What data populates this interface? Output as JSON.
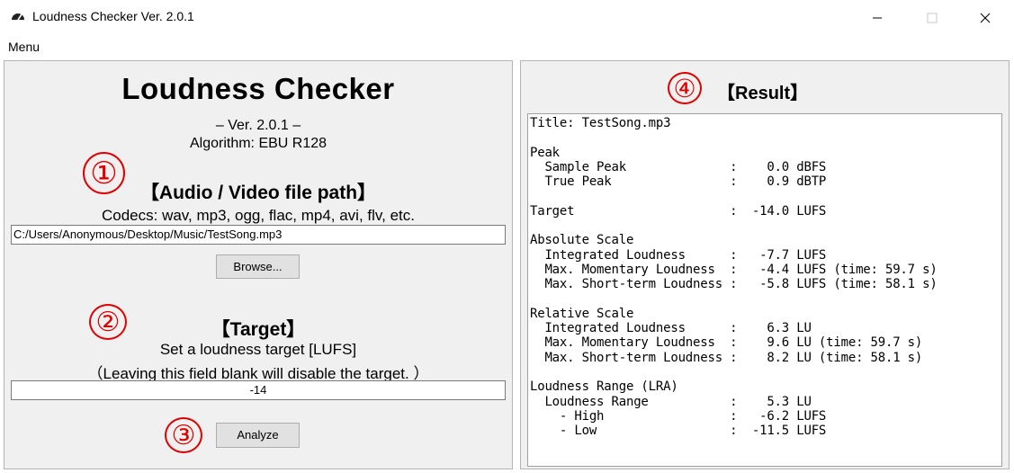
{
  "window": {
    "title": "Loudness Checker Ver. 2.0.1",
    "icon": "gauge-icon",
    "minimize_glyph": "—",
    "maximize_glyph": "☐",
    "close_glyph": "✕"
  },
  "menu": {
    "label": "Menu"
  },
  "left": {
    "heading": "Loudness Checker",
    "version": "– Ver. 2.0.1 –",
    "algorithm": "Algorithm: EBU R128",
    "file_section": {
      "marker": "①",
      "title": "【Audio / Video file path】",
      "codecs": "Codecs: wav, mp3, ogg, flac, mp4, avi, flv, etc.",
      "path_value": "C:/Users/Anonymous/Desktop/Music/TestSong.mp3",
      "browse_label": "Browse..."
    },
    "target_section": {
      "marker": "②",
      "title": "【Target】",
      "desc1": "Set a loudness target [LUFS]",
      "desc2": "（Leaving this field blank will disable the target. ）",
      "value": "-14"
    },
    "analyze": {
      "marker": "③",
      "label": "Analyze"
    }
  },
  "right": {
    "marker": "④",
    "title": "【Result】",
    "lines": [
      "Title: TestSong.mp3",
      "",
      "Peak",
      "  Sample Peak              :    0.0 dBFS",
      "  True Peak                :    0.9 dBTP",
      "",
      "Target                     :  -14.0 LUFS",
      "",
      "Absolute Scale",
      "  Integrated Loudness      :   -7.7 LUFS",
      "  Max. Momentary Loudness  :   -4.4 LUFS (time: 59.7 s)",
      "  Max. Short-term Loudness :   -5.8 LUFS (time: 58.1 s)",
      "",
      "Relative Scale",
      "  Integrated Loudness      :    6.3 LU",
      "  Max. Momentary Loudness  :    9.6 LU (time: 59.7 s)",
      "  Max. Short-term Loudness :    8.2 LU (time: 58.1 s)",
      "",
      "Loudness Range (LRA)",
      "  Loudness Range           :    5.3 LU",
      "    - High                 :   -6.2 LUFS",
      "    - Low                  :  -11.5 LUFS"
    ]
  },
  "colors": {
    "marker": "#e00000",
    "panel_bg": "#f0f0f0",
    "button_bg": "#e1e1e1"
  }
}
